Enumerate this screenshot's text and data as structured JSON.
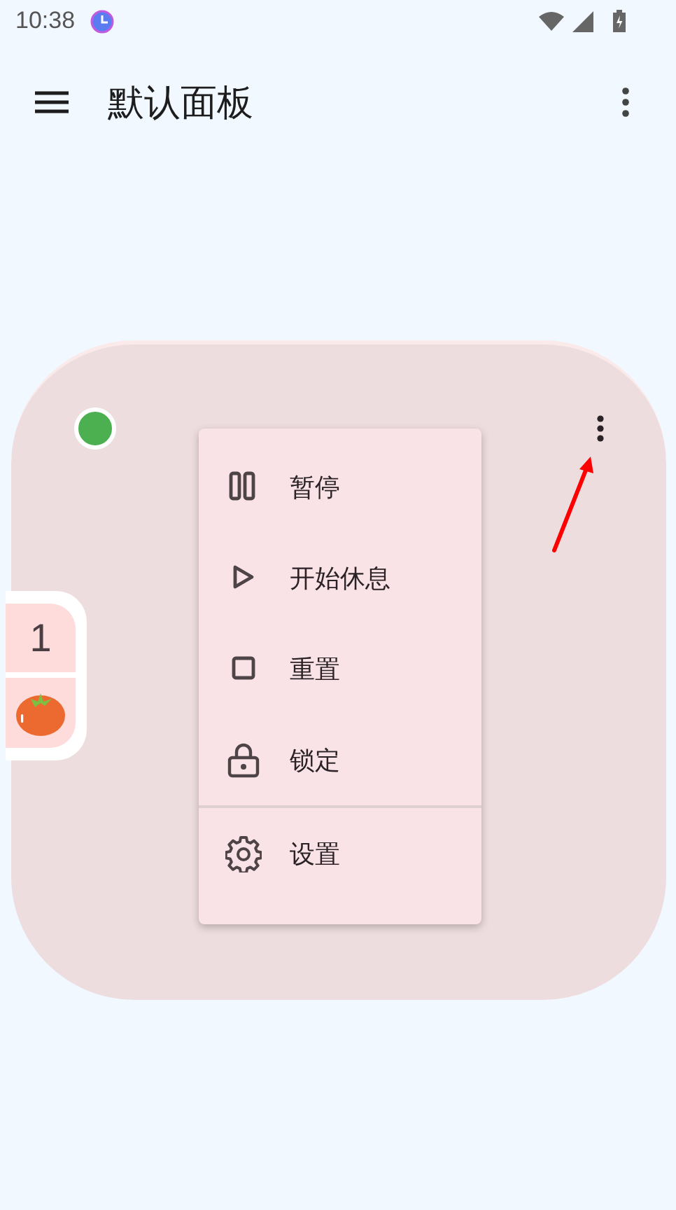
{
  "status_bar": {
    "time": "10:38"
  },
  "app_bar": {
    "title": "默认面板"
  },
  "card": {
    "status_dot": {
      "color": "#4caf50"
    },
    "counter": {
      "count": "1"
    },
    "menu": {
      "items": [
        {
          "label": "暂停",
          "kind": "pause",
          "divider_before": false
        },
        {
          "label": "开始休息",
          "kind": "play",
          "divider_before": false
        },
        {
          "label": "重置",
          "kind": "stop",
          "divider_before": false
        },
        {
          "label": "锁定",
          "kind": "lock",
          "divider_before": false
        },
        {
          "label": "设置",
          "kind": "gear",
          "divider_before": true
        }
      ]
    }
  }
}
